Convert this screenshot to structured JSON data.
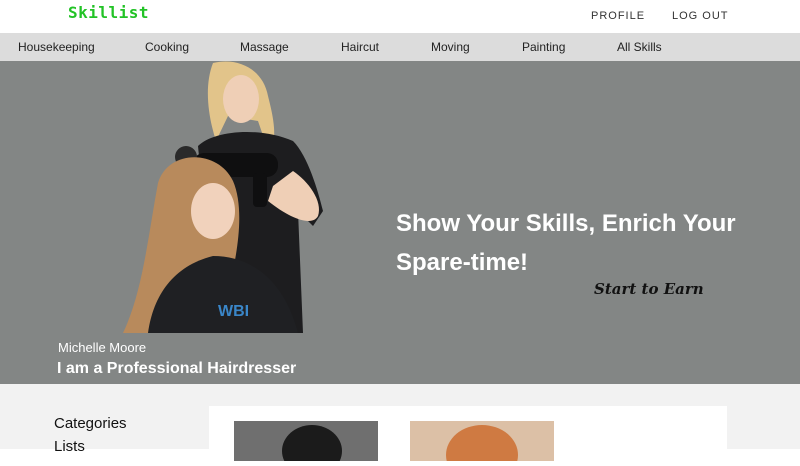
{
  "header": {
    "logo": "Skillist",
    "nav": [
      "PROFILE",
      "LOG OUT"
    ]
  },
  "categories": [
    "Housekeeping",
    "Cooking",
    "Massage",
    "Haircut",
    "Moving",
    "Painting",
    "All Skills"
  ],
  "hero": {
    "headline_line1": "Show Your Skills, Enrich Your",
    "headline_line2": "Spare-time!",
    "cta": "Start to Earn",
    "person_name": "Michelle Moore",
    "person_title": "I am a Professional Hairdresser",
    "apron_text": "WBI"
  },
  "sidebar": {
    "items": [
      "Categories",
      "Lists"
    ]
  },
  "colors": {
    "brand": "#22c326",
    "hero_bg": "#838685",
    "nav_bg": "#dcdcdc"
  }
}
